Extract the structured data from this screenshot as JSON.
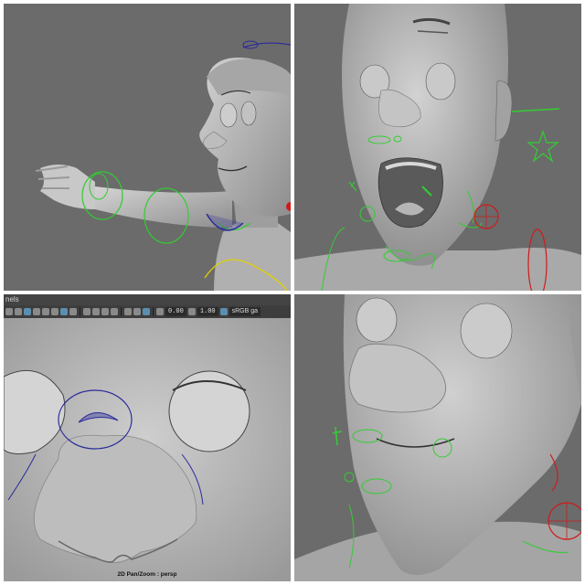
{
  "panels": [
    {
      "id": "top-left",
      "desc_name": "viewport-character-arm"
    },
    {
      "id": "top-right",
      "desc_name": "viewport-face-mouth-open"
    },
    {
      "id": "bottom-left",
      "desc_name": "viewport-nose-closeup"
    },
    {
      "id": "bottom-right",
      "desc_name": "viewport-face-smile"
    }
  ],
  "viewport3": {
    "menu_text": "nels",
    "gamma_field": "0.00",
    "exposure_field": "1.00",
    "color_space": "sRGB ga",
    "hud_label": "2D Pan/Zoom : persp"
  },
  "colors": {
    "viewport_bg": "#6b6b6b",
    "mesh": "#b9b9b9",
    "ctrl_green": "#33cc33",
    "ctrl_blue": "#2a2a9a",
    "ctrl_red": "#d11a1a",
    "ctrl_yellow": "#e0d000"
  }
}
